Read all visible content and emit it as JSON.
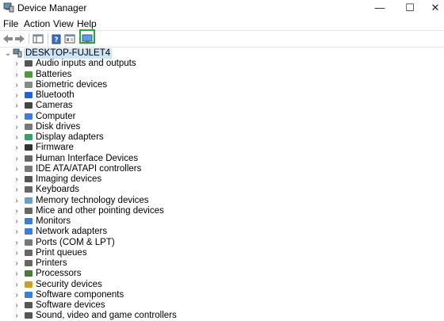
{
  "window": {
    "title": "Device Manager"
  },
  "menu": [
    "File",
    "Action",
    "View",
    "Help"
  ],
  "toolbar": {
    "buttons": [
      {
        "name": "back-button",
        "icon": "arrow-left-icon"
      },
      {
        "name": "forward-button",
        "icon": "arrow-right-icon"
      },
      {
        "name": "show-hide-console-tree-button",
        "icon": "console-tree-icon"
      },
      {
        "name": "help-button",
        "icon": "help-icon"
      },
      {
        "name": "properties-button",
        "icon": "properties-icon"
      },
      {
        "name": "scan-hardware-button",
        "icon": "monitor-scan-icon"
      }
    ]
  },
  "tree": {
    "root": "DESKTOP-FUJLET4",
    "items": [
      {
        "label": "Audio inputs and outputs",
        "icon": "speaker-icon"
      },
      {
        "label": "Batteries",
        "icon": "battery-icon"
      },
      {
        "label": "Biometric devices",
        "icon": "fingerprint-icon"
      },
      {
        "label": "Bluetooth",
        "icon": "bluetooth-icon"
      },
      {
        "label": "Cameras",
        "icon": "camera-icon"
      },
      {
        "label": "Computer",
        "icon": "computer-icon"
      },
      {
        "label": "Disk drives",
        "icon": "disk-icon"
      },
      {
        "label": "Display adapters",
        "icon": "display-adapter-icon"
      },
      {
        "label": "Firmware",
        "icon": "firmware-icon"
      },
      {
        "label": "Human Interface Devices",
        "icon": "hid-icon"
      },
      {
        "label": "IDE ATA/ATAPI controllers",
        "icon": "ide-icon"
      },
      {
        "label": "Imaging devices",
        "icon": "imaging-icon"
      },
      {
        "label": "Keyboards",
        "icon": "keyboard-icon"
      },
      {
        "label": "Memory technology devices",
        "icon": "memory-icon"
      },
      {
        "label": "Mice and other pointing devices",
        "icon": "mouse-icon"
      },
      {
        "label": "Monitors",
        "icon": "monitor-icon"
      },
      {
        "label": "Network adapters",
        "icon": "network-icon"
      },
      {
        "label": "Ports (COM & LPT)",
        "icon": "port-icon"
      },
      {
        "label": "Print queues",
        "icon": "print-queue-icon"
      },
      {
        "label": "Printers",
        "icon": "printer-icon"
      },
      {
        "label": "Processors",
        "icon": "processor-icon"
      },
      {
        "label": "Security devices",
        "icon": "security-icon"
      },
      {
        "label": "Software components",
        "icon": "software-component-icon"
      },
      {
        "label": "Software devices",
        "icon": "software-device-icon"
      },
      {
        "label": "Sound, video and game controllers",
        "icon": "sound-icon"
      }
    ]
  },
  "colors": {
    "highlight": "#2ea33a",
    "selection": "#cde4f7",
    "accent": "#3b7dd8"
  }
}
